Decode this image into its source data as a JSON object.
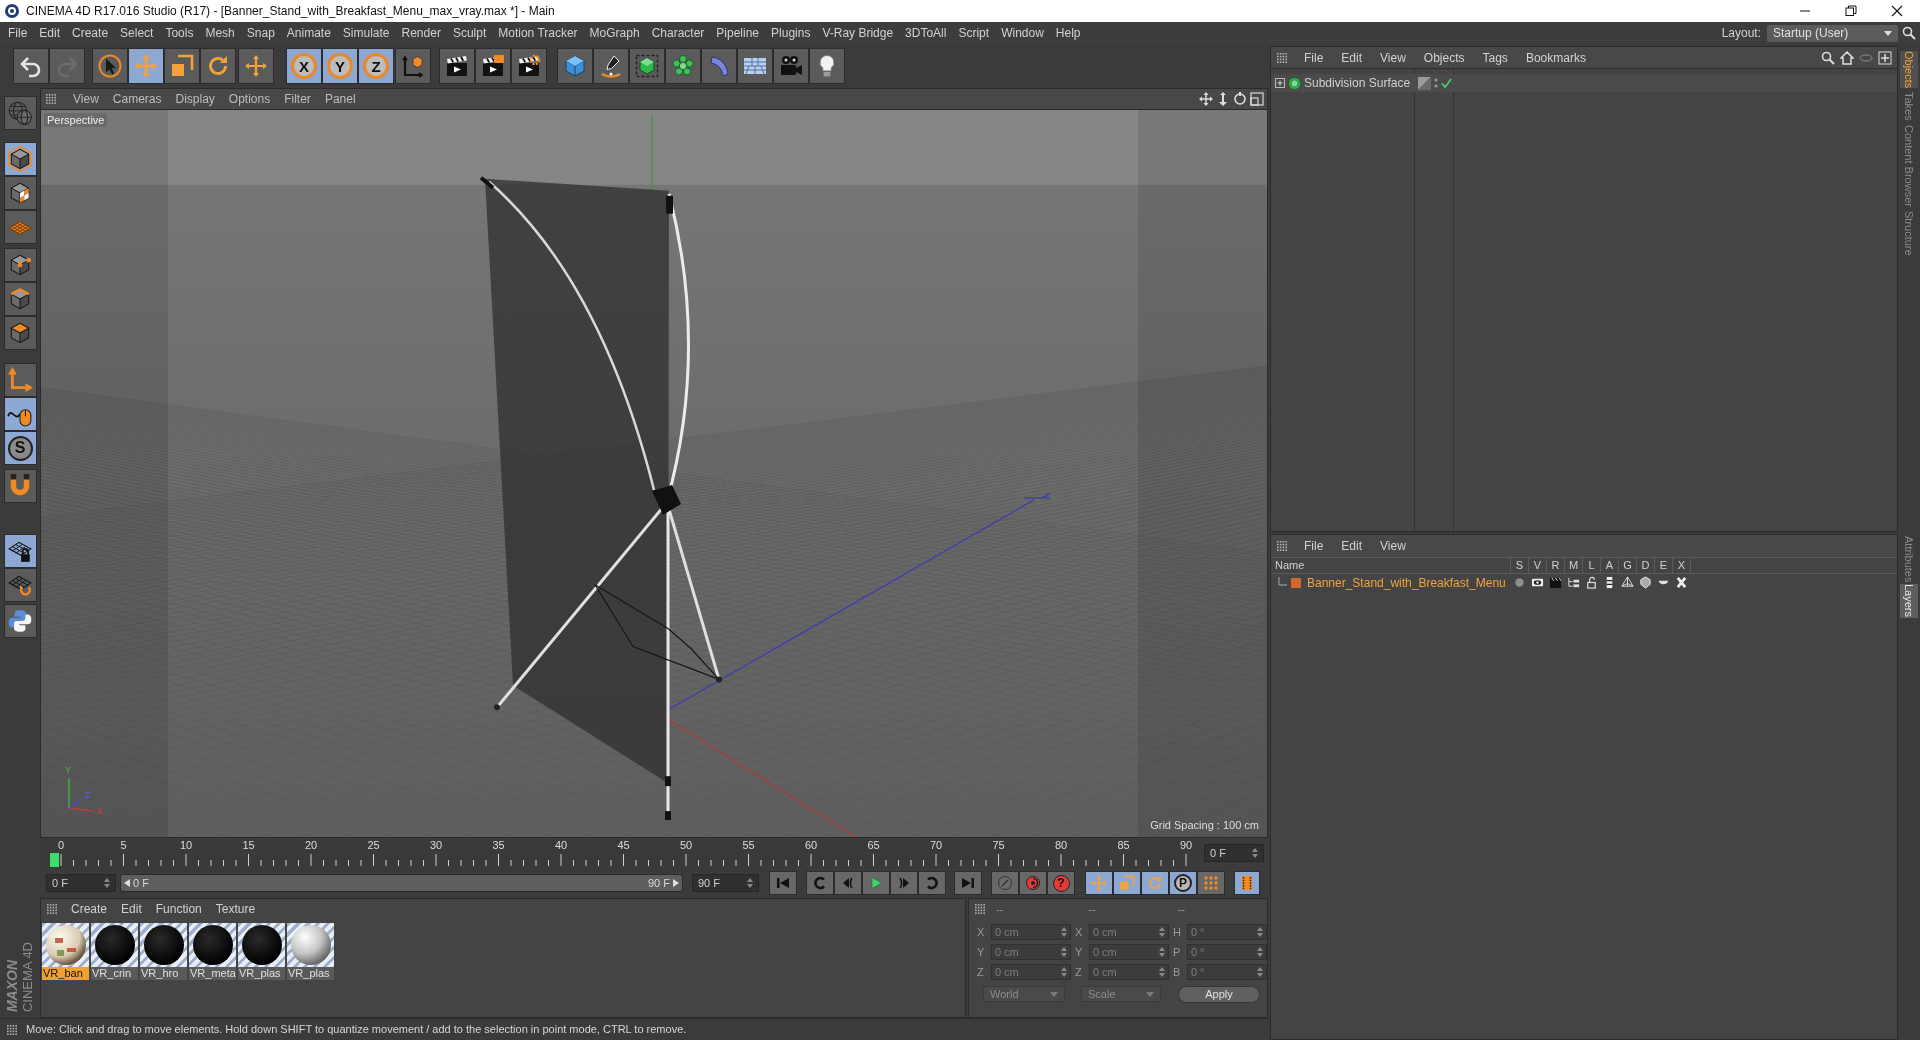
{
  "window": {
    "title": "CINEMA 4D R17.016 Studio (R17) - [Banner_Stand_with_Breakfast_Menu_max_vray.max *] - Main"
  },
  "menu_bar": {
    "items": [
      "File",
      "Edit",
      "Create",
      "Select",
      "Tools",
      "Mesh",
      "Snap",
      "Animate",
      "Simulate",
      "Render",
      "Sculpt",
      "Motion Tracker",
      "MoGraph",
      "Character",
      "Pipeline",
      "Plugins",
      "V-Ray Bridge",
      "3DToAll",
      "Script",
      "Window",
      "Help"
    ],
    "layout_label": "Layout:",
    "layout_value": "Startup (User)"
  },
  "toolbar": {
    "groups": [
      [
        {
          "selected": false,
          "disabled": false
        },
        {
          "selected": false,
          "disabled": true
        }
      ],
      [
        {
          "selected": false
        },
        {
          "selected": true
        },
        {
          "selected": false
        },
        {
          "selected": false
        }
      ],
      [
        {
          "selected": false
        }
      ],
      [
        {
          "label": "X",
          "selected": true
        },
        {
          "label": "Y",
          "selected": true
        },
        {
          "label": "Z",
          "selected": true
        }
      ],
      [
        {
          "selected": false
        }
      ],
      [
        {
          "selected": false
        },
        {
          "selected": false
        },
        {
          "selected": false
        }
      ],
      [
        {
          "selected": false
        },
        {
          "selected": false
        },
        {
          "selected": false
        },
        {
          "selected": false
        },
        {
          "selected": false
        },
        {
          "selected": false
        },
        {
          "selected": false
        },
        {
          "selected": false
        }
      ]
    ]
  },
  "left_toolbar": {
    "groups": [
      [
        {
          "selected": false
        }
      ],
      [
        {
          "selected": true
        },
        {
          "selected": false
        },
        {
          "selected": false
        }
      ],
      [
        {
          "selected": false
        },
        {
          "selected": false
        },
        {
          "selected": false
        }
      ],
      [
        {
          "selected": false
        },
        {
          "selected": true
        },
        {
          "label": "S",
          "selected": true
        }
      ],
      [
        {
          "selected": false
        }
      ],
      [
        {
          "selected": true
        },
        {
          "selected": false
        }
      ],
      [
        {
          "selected": false
        }
      ]
    ]
  },
  "viewport": {
    "menu": [
      "View",
      "Cameras",
      "Display",
      "Options",
      "Filter",
      "Panel"
    ],
    "camera": "Perspective",
    "grid_spacing": "Grid Spacing : 100 cm",
    "axis_labels": [
      "Y",
      "X",
      "Z"
    ]
  },
  "timeline": {
    "ruler": {
      "ticks": [
        "0",
        "5",
        "10",
        "15",
        "20",
        "25",
        "30",
        "35",
        "40",
        "45",
        "50",
        "55",
        "60",
        "65",
        "70",
        "75",
        "80",
        "85",
        "90"
      ],
      "level": 0
    },
    "current_frame": "0 F",
    "start_field": "0 F",
    "preview_range": {
      "start": "0 F",
      "end": "90 F",
      "level": 1
    },
    "end_field": "90 F",
    "record_buttons": [
      {
        "disabled": true
      },
      {
        "disabled": false
      },
      {
        "label": "?",
        "disabled": false
      }
    ],
    "key_buttons": [
      {
        "selected": true
      },
      {
        "selected": true
      },
      {
        "selected": true
      },
      {
        "label": "P",
        "selected": true
      },
      {
        "selected": false
      }
    ],
    "timeline_button": {
      "selected": true
    }
  },
  "materials": {
    "menu": [
      "Create",
      "Edit",
      "Function",
      "Texture"
    ],
    "items": [
      {
        "label": "VR_ban",
        "kind": "textured",
        "selected": true
      },
      {
        "label": "VR_crin",
        "kind": "black",
        "selected": false
      },
      {
        "label": "VR_hro",
        "kind": "black",
        "selected": false
      },
      {
        "label": "VR_meta",
        "kind": "black",
        "selected": false
      },
      {
        "label": "VR_plas",
        "kind": "black",
        "selected": false
      },
      {
        "label": "VR_plas",
        "kind": "white",
        "selected": false
      }
    ]
  },
  "coordinates": {
    "headers": [
      "--",
      "--",
      "--"
    ],
    "rows": [
      [
        {
          "axis": "X",
          "value": "0 cm"
        },
        {
          "axis": "X",
          "value": "0 cm"
        },
        {
          "axis": "H",
          "value": "0 °"
        }
      ],
      [
        {
          "axis": "Y",
          "value": "0 cm"
        },
        {
          "axis": "Y",
          "value": "0 cm"
        },
        {
          "axis": "P",
          "value": "0 °"
        }
      ],
      [
        {
          "axis": "Z",
          "value": "0 cm"
        },
        {
          "axis": "Z",
          "value": "0 cm"
        },
        {
          "axis": "B",
          "value": "0 °"
        }
      ]
    ],
    "dropdowns": [
      "World",
      "Scale"
    ],
    "apply": "Apply"
  },
  "object_manager": {
    "menu": [
      "File",
      "Edit",
      "View",
      "Objects",
      "Tags",
      "Bookmarks"
    ],
    "objects": [
      {
        "name": "Subdivision Surface",
        "expanded": false,
        "enabled": true
      }
    ]
  },
  "layer_manager": {
    "menu": [
      "File",
      "Edit",
      "View"
    ],
    "columns": [
      "Name",
      "S",
      "V",
      "R",
      "M",
      "L",
      "A",
      "G",
      "D",
      "E",
      "X"
    ],
    "layers": [
      {
        "name": "Banner_Stand_with_Breakfast_Menu",
        "color": "#d4652b",
        "selected": true
      }
    ]
  },
  "side_tabs": {
    "top": [
      {
        "label": "Objects",
        "selected": true
      },
      {
        "label": "Takes",
        "selected": false
      },
      {
        "label": "Content Browser",
        "selected": false
      },
      {
        "label": "Structure",
        "selected": false
      }
    ],
    "bottom": [
      {
        "label": "Attributes",
        "selected": false
      },
      {
        "label": "Layers",
        "selected": true
      }
    ]
  },
  "logo": {
    "brand": "MAXON",
    "product": "CINEMA 4D"
  },
  "status_bar": {
    "text": "Move: Click and drag to move elements. Hold down SHIFT to quantize movement / add to the selection in point mode, CTRL to remove."
  }
}
